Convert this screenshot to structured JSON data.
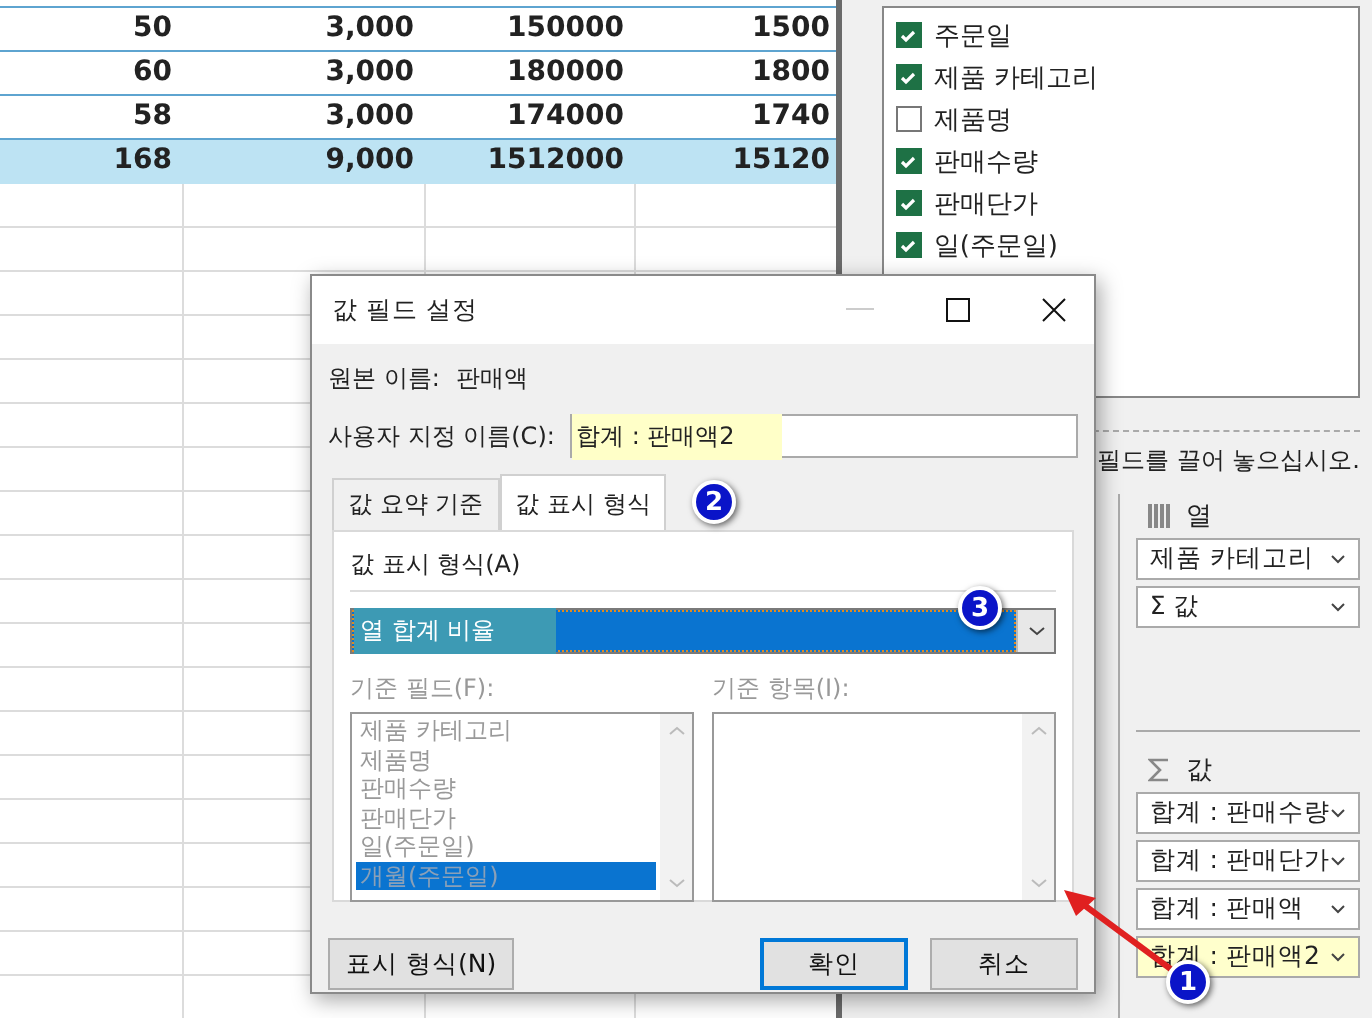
{
  "spreadsheet": {
    "rows": [
      {
        "cells": [
          "50",
          "3,000",
          "150000",
          "1500"
        ],
        "total": false
      },
      {
        "cells": [
          "60",
          "3,000",
          "180000",
          "1800"
        ],
        "total": false
      },
      {
        "cells": [
          "58",
          "3,000",
          "174000",
          "1740"
        ],
        "total": false
      },
      {
        "cells": [
          "168",
          "9,000",
          "1512000",
          "15120"
        ],
        "total": true
      }
    ]
  },
  "field_list": {
    "fields": [
      {
        "label": "주문일",
        "checked": true
      },
      {
        "label": "제품 카테고리",
        "checked": true
      },
      {
        "label": "제품명",
        "checked": false
      },
      {
        "label": "판매수량",
        "checked": true
      },
      {
        "label": "판매단가",
        "checked": true
      },
      {
        "label": "일(주문일)",
        "checked": true
      }
    ]
  },
  "drop_hint": "필드를 끌어 놓으십시오.",
  "columns_area": {
    "title": "열",
    "items": [
      "제품 카테고리",
      "Σ 값"
    ]
  },
  "values_area": {
    "title": "값",
    "items": [
      {
        "label": "합계 : 판매수량",
        "highlighted": false
      },
      {
        "label": "합계 : 판매단가",
        "highlighted": false
      },
      {
        "label": "합계 : 판매액",
        "highlighted": false
      },
      {
        "label": "합계 : 판매액2",
        "highlighted": true
      }
    ]
  },
  "dialog": {
    "title": "값 필드 설정",
    "source_label": "원본 이름:",
    "source_value": "판매액",
    "custom_name_label": "사용자 지정 이름(C):",
    "custom_name_value": "합계 : 판매액2",
    "tabs": [
      {
        "label": "값 요약 기준",
        "selected": false
      },
      {
        "label": "값 표시 형식",
        "selected": true
      }
    ],
    "show_as_label": "값 표시 형식(A)",
    "show_as_value": "열 합계 비율",
    "base_field_label": "기준 필드(F):",
    "base_item_label": "기준 항목(I):",
    "base_fields": [
      {
        "label": "제품 카테고리",
        "selected": false
      },
      {
        "label": "제품명",
        "selected": false
      },
      {
        "label": "판매수량",
        "selected": false
      },
      {
        "label": "판매단가",
        "selected": false
      },
      {
        "label": "일(주문일)",
        "selected": false
      },
      {
        "label": "개월(주문일)",
        "selected": true
      }
    ],
    "buttons": [
      {
        "label": "표시 형식(N)",
        "kind": "normal"
      },
      {
        "label": "확인",
        "kind": "default"
      },
      {
        "label": "취소",
        "kind": "normal"
      }
    ]
  },
  "annotations": [
    "1",
    "2",
    "3"
  ]
}
